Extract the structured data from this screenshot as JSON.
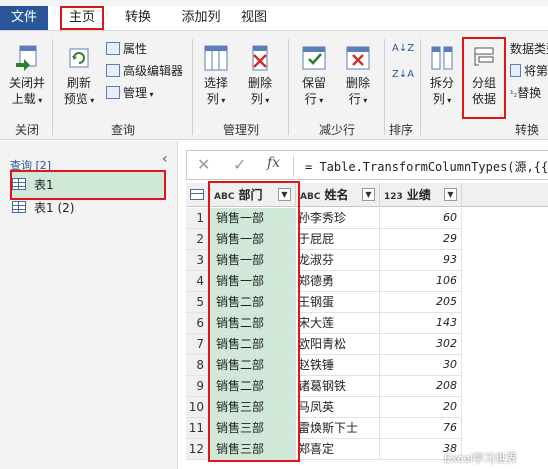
{
  "menu": {
    "file": "文件",
    "home": "主页",
    "transform": "转换",
    "add_column": "添加列",
    "view": "视图"
  },
  "ribbon": {
    "close_load_1": "关闭并",
    "close_load_2": "上载",
    "group_close": "关闭",
    "refresh_1": "刷新",
    "refresh_2": "预览",
    "properties": "属性",
    "advanced_editor": "高级编辑器",
    "manage": "管理",
    "group_query": "查询",
    "choose_cols_1": "选择",
    "choose_cols_2": "列",
    "remove_cols_1": "删除",
    "remove_cols_2": "列",
    "group_manage_cols": "管理列",
    "keep_rows_1": "保留",
    "keep_rows_2": "行",
    "remove_rows_1": "删除",
    "remove_rows_2": "行",
    "group_reduce_rows": "减少行",
    "group_sort": "排序",
    "split_col_1": "拆分",
    "split_col_2": "列",
    "group_by_1": "分组",
    "group_by_2": "依据",
    "data_type": "数据类型",
    "use_first_row": "将第",
    "replace_values": "替换",
    "group_transform": "转换"
  },
  "queries": {
    "header": "查询 [2]",
    "items": [
      "表1",
      "表1 (2)"
    ]
  },
  "formula": {
    "fx": "fx",
    "text": "= Table.TransformColumnTypes(源,{{\"部"
  },
  "table": {
    "headers": {
      "dept_type": "ABC",
      "dept": "部门",
      "name_type": "ABC",
      "name": "姓名",
      "score_type": "123",
      "score": "业绩"
    },
    "rows": [
      {
        "idx": "1",
        "dept": "销售一部",
        "name": "孙李秀珍",
        "score": "60"
      },
      {
        "idx": "2",
        "dept": "销售一部",
        "name": "于屁屁",
        "score": "29"
      },
      {
        "idx": "3",
        "dept": "销售一部",
        "name": "龙淑芬",
        "score": "93"
      },
      {
        "idx": "4",
        "dept": "销售一部",
        "name": "郑德勇",
        "score": "106"
      },
      {
        "idx": "5",
        "dept": "销售二部",
        "name": "王钢蛋",
        "score": "205"
      },
      {
        "idx": "6",
        "dept": "销售二部",
        "name": "宋大莲",
        "score": "143"
      },
      {
        "idx": "7",
        "dept": "销售二部",
        "name": "欧阳青松",
        "score": "302"
      },
      {
        "idx": "8",
        "dept": "销售二部",
        "name": "赵铁锤",
        "score": "30"
      },
      {
        "idx": "9",
        "dept": "销售二部",
        "name": "诸葛钢铁",
        "score": "208"
      },
      {
        "idx": "10",
        "dept": "销售三部",
        "name": "马凤英",
        "score": "20"
      },
      {
        "idx": "11",
        "dept": "销售三部",
        "name": "雷焕斯下士",
        "score": "76"
      },
      {
        "idx": "12",
        "dept": "销售三部",
        "name": "郑喜定",
        "score": "38"
      }
    ]
  },
  "watermark": "Excel学习世界",
  "colors": {
    "accent": "#2b579a",
    "highlight": "#e0151c",
    "selection": "#cfe8d8"
  }
}
